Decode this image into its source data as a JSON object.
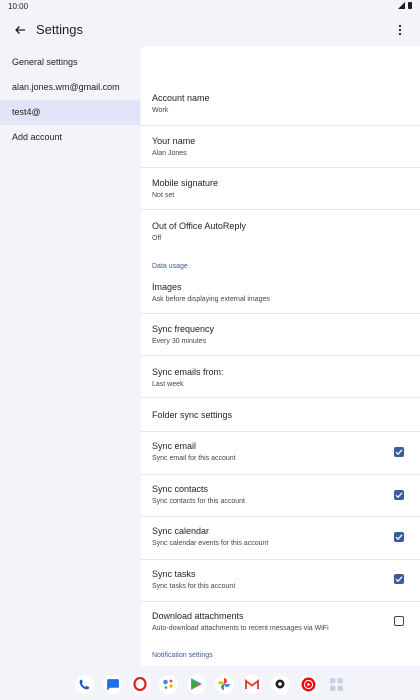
{
  "status_bar": {
    "time": "10:00"
  },
  "app_bar": {
    "title": "Settings"
  },
  "left_nav": {
    "items": [
      {
        "label": "General settings"
      },
      {
        "label": "alan.jones.wm@gmail.com"
      },
      {
        "label": "test4@"
      },
      {
        "label": "Add account"
      }
    ]
  },
  "settings": {
    "account_name": {
      "title": "Account name",
      "value": "Work"
    },
    "your_name": {
      "title": "Your name",
      "value": "Alan Jones"
    },
    "mobile_signature": {
      "title": "Mobile signature",
      "value": "Not set"
    },
    "ooo": {
      "title": "Out of Office AutoReply",
      "value": "Off"
    },
    "data_usage_label": "Data usage",
    "images": {
      "title": "Images",
      "value": "Ask before displaying external images"
    },
    "sync_frequency": {
      "title": "Sync frequency",
      "value": "Every 30 minutes"
    },
    "sync_emails_from": {
      "title": "Sync emails from:",
      "value": "Last week"
    },
    "folder_sync": {
      "title": "Folder sync settings"
    },
    "sync_email": {
      "title": "Sync email",
      "value": "Sync email for this account",
      "checked": true
    },
    "sync_contacts": {
      "title": "Sync contacts",
      "value": "Sync contacts for this account",
      "checked": true
    },
    "sync_calendar": {
      "title": "Sync calendar",
      "value": "Sync calendar events for this account",
      "checked": true
    },
    "sync_tasks": {
      "title": "Sync tasks",
      "value": "Sync tasks for this account",
      "checked": true
    },
    "download_attachments": {
      "title": "Download attachments",
      "value": "Auto-download attachments to recent messages via WiFi",
      "checked": false
    },
    "notification_label": "Notification settings"
  },
  "dock": {
    "apps": [
      "phone-app-icon",
      "messages-app-icon",
      "opera-app-icon",
      "assistant-app-icon",
      "play-store-app-icon",
      "photos-app-icon",
      "gmail-app-icon",
      "settings-app-icon",
      "youtube-music-app-icon",
      "app-drawer-icon"
    ],
    "accent": "#3a5ba0"
  }
}
